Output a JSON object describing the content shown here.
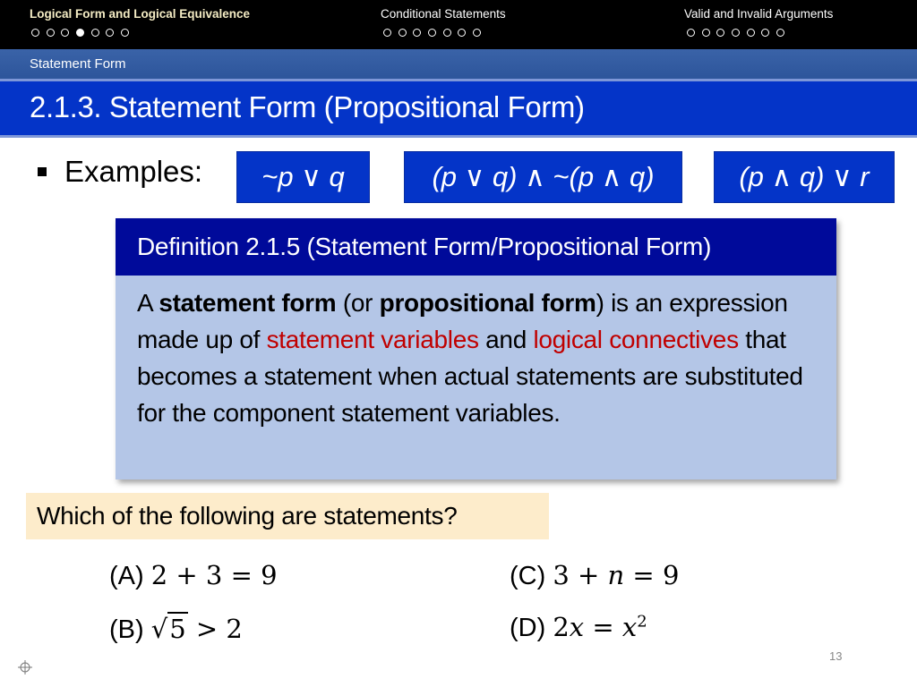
{
  "nav": {
    "sections": [
      {
        "title": "Logical Form and Logical Equivalence",
        "active": true,
        "dot_count": 7,
        "current_dot": 3
      },
      {
        "title": "Conditional Statements",
        "active": false,
        "dot_count": 7,
        "current_dot": -1
      },
      {
        "title": "Valid and Invalid Arguments",
        "active": false,
        "dot_count": 7,
        "current_dot": -1
      }
    ]
  },
  "subtitle": "Statement Form",
  "slide_title": "2.1.3. Statement Form (Propositional Form)",
  "examples": {
    "label": "Examples:",
    "expressions": [
      "~p ∨ q",
      "(p ∨ q) ∧ ~(p ∧ q)",
      "(p ∧ q) ∨ r"
    ]
  },
  "definition": {
    "heading": "Definition 2.1.5 (Statement Form/Propositional Form)",
    "parts": {
      "p1": "A ",
      "b1": "statement form",
      "p2": " (or ",
      "b2": "propositional form",
      "p3": ") is an expression made up of ",
      "r1": "statement variables",
      "p4": " and ",
      "r2": "logical connectives",
      "p5": " that becomes a statement when actual statements are substituted for the component statement variables."
    }
  },
  "question": "Which of the following are statements?",
  "options": {
    "A": {
      "label": "(A)",
      "expr": "2 + 3 = 9"
    },
    "B": {
      "label": "(B)",
      "radicand": "5",
      "rest": " > 2"
    },
    "C": {
      "label": "(C)",
      "pre": "3 + ",
      "var": "n",
      "post": " = 9"
    },
    "D": {
      "label": "(D)",
      "pre": "2",
      "var1": "x",
      "mid": " = ",
      "var2": "x",
      "sup": "2"
    }
  },
  "page_number": "13",
  "colors": {
    "title_blue": "#0434c8",
    "def_head": "#000a9a",
    "def_body": "#b4c6e7",
    "highlight_red": "#c00000",
    "question_bg": "#fdeccb"
  }
}
